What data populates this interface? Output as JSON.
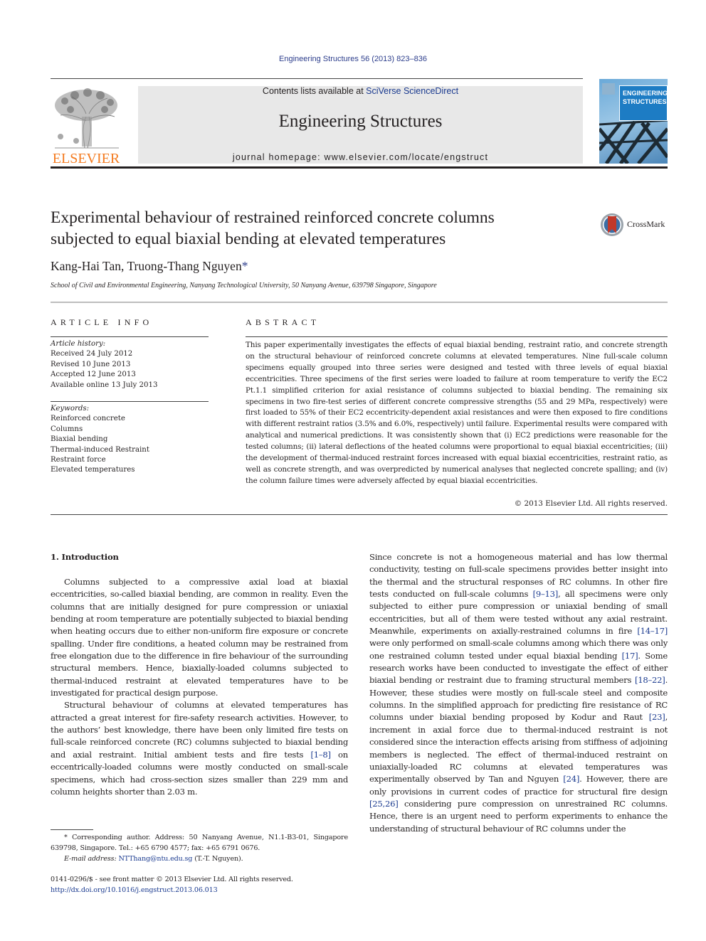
{
  "header": {
    "journal_ref": "Engineering Structures 56 (2013) 823–836",
    "contents_prefix": "Contents lists available at ",
    "contents_link": "SciVerse ScienceDirect",
    "journal_name": "Engineering Structures",
    "homepage_prefix": "journal homepage: ",
    "homepage_url": "www.elsevier.com/locate/engstruct",
    "publisher_logo_text": "ELSEVIER",
    "cover_title_line1": "ENGINEERING",
    "cover_title_line2": "STRUCTURES",
    "colors": {
      "publisher_orange": "#f47b20",
      "link_blue": "#1a3a8f",
      "banner_gray": "#e8e8e8"
    }
  },
  "article": {
    "title_line1": "Experimental behaviour of restrained reinforced concrete columns",
    "title_line2": "subjected to equal biaxial bending at elevated temperatures",
    "crossmark_label": "CrossMark",
    "authors": "Kang-Hai Tan, Truong-Thang Nguyen",
    "author_mark": "*",
    "affiliation": "School of Civil and Environmental Engineering, Nanyang Technological University, 50 Nanyang Avenue, 639798 Singapore, Singapore"
  },
  "article_info": {
    "heading": "ARTICLE INFO",
    "history_label": "Article history:",
    "history": [
      "Received 24 July 2012",
      "Revised 10 June 2013",
      "Accepted 12 June 2013",
      "Available online 13 July 2013"
    ],
    "keywords_label": "Keywords:",
    "keywords": [
      "Reinforced concrete",
      "Columns",
      "Biaxial bending",
      "Thermal-induced Restraint",
      "Restraint force",
      "Elevated temperatures"
    ]
  },
  "abstract": {
    "heading": "ABSTRACT",
    "text": "This paper experimentally investigates the effects of equal biaxial bending, restraint ratio, and concrete strength on the structural behaviour of reinforced concrete columns at elevated temperatures. Nine full-scale column specimens equally grouped into three series were designed and tested with three levels of equal biaxial eccentricities. Three specimens of the first series were loaded to failure at room temperature to verify the EC2 Pt.1.1 simplified criterion for axial resistance of columns subjected to biaxial bending. The remaining six specimens in two fire-test series of different concrete compressive strengths (55 and 29 MPa, respectively) were first loaded to 55% of their EC2 eccentricity-dependent axial resistances and were then exposed to fire conditions with different restraint ratios (3.5% and 6.0%, respectively) until failure. Experimental results were compared with analytical and numerical predictions. It was consistently shown that (i) EC2 predictions were reasonable for the tested columns; (ii) lateral deflections of the heated columns were proportional to equal biaxial eccentricities; (iii) the development of thermal-induced restraint forces increased with equal biaxial eccentricities, restraint ratio, as well as concrete strength, and was overpredicted by numerical analyses that neglected concrete spalling; and (iv) the column failure times were adversely affected by equal biaxial eccentricities.",
    "copyright": "© 2013 Elsevier Ltd. All rights reserved."
  },
  "body": {
    "section_heading": "1. Introduction",
    "left": {
      "p1": "Columns subjected to a compressive axial load at biaxial eccentricities, so-called biaxial bending, are common in reality. Even the columns that are initially designed for pure compression or uniaxial bending at room temperature are potentially subjected to biaxial bending when heating occurs due to either non-uniform fire exposure or concrete spalling. Under fire conditions, a heated column may be restrained from free elongation due to the difference in fire behaviour of the surrounding structural members. Hence, biaxially-loaded columns subjected to thermal-induced restraint at elevated temperatures have to be investigated for practical design purpose.",
      "p2_a": "Structural behaviour of columns at elevated temperatures has attracted a great interest for fire-safety research activities. However, to the authors’ best knowledge, there have been only limited fire tests on full-scale reinforced concrete (RC) columns subjected to biaxial bending and axial restraint. Initial ambient tests and fire tests ",
      "p2_ref": "[1–8]",
      "p2_b": " on eccentrically-loaded columns were mostly conducted on small-scale specimens, which had cross-section sizes smaller than 229 mm and column heights shorter than 2.03 m."
    },
    "right": {
      "s1": "Since concrete is not a homogeneous material and has low thermal conductivity, testing on full-scale specimens provides better insight into the thermal and the structural responses of RC columns. In other fire tests conducted on full-scale columns ",
      "r1": "[9–13]",
      "s2": ", all specimens were only subjected to either pure compression or uniaxial bending of small eccentricities, but all of them were tested without any axial restraint. Meanwhile, experiments on axially-restrained columns in fire ",
      "r2": "[14–17]",
      "s3": " were only performed on small-scale columns among which there was only one restrained column tested under equal biaxial bending ",
      "r3": "[17]",
      "s4": ". Some research works have been conducted to investigate the effect of either biaxial bending or restraint due to framing structural members ",
      "r4": "[18–22]",
      "s5": ". However, these studies were mostly on full-scale steel and composite columns. In the simplified approach for predicting fire resistance of RC columns under biaxial bending proposed by Kodur and Raut ",
      "r5": "[23]",
      "s6": ", increment in axial force due to thermal-induced restraint is not considered since the interaction effects arising from stiffness of adjoining members is neglected. The effect of thermal-induced restraint on uniaxially-loaded RC columns at elevated temperatures was experimentally observed by Tan and Nguyen ",
      "r6": "[24]",
      "s7": ". However, there are only provisions in current codes of practice for structural fire design ",
      "r7": "[25,26]",
      "s8": " considering pure compression on unrestrained RC columns. Hence, there is an urgent need to perform experiments to enhance the understanding of structural behaviour of RC columns under the"
    }
  },
  "footnote": {
    "mark": "*",
    "text": " Corresponding author. Address: 50 Nanyang Avenue, N1.1-B3-01, Singapore 639798, Singapore. Tel.: +65 6790 4577; fax: +65 6791 0676.",
    "email_label": "E-mail address:",
    "email": "NTThang@ntu.edu.sg",
    "email_suffix": " (T.-T. Nguyen)."
  },
  "issn": {
    "line": "0141-0296/$ - see front matter © 2013 Elsevier Ltd. All rights reserved.",
    "doi": "http://dx.doi.org/10.1016/j.engstruct.2013.06.013"
  }
}
